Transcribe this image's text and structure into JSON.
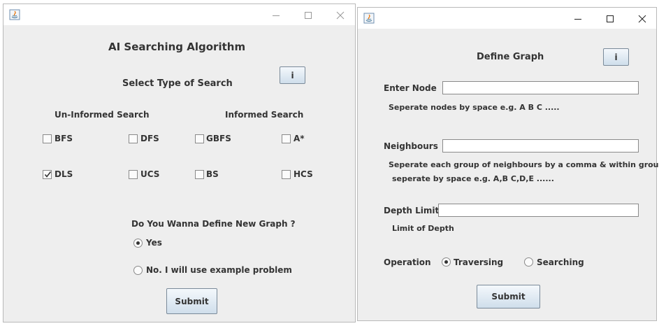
{
  "window1": {
    "title": "AI Searching Algorithm",
    "select_label": "Select Type of Search",
    "info_button": "i",
    "uninformed_label": "Un-Informed Search",
    "informed_label": "Informed Search",
    "options": {
      "bfs": {
        "label": "BFS",
        "checked": false
      },
      "dfs": {
        "label": "DFS",
        "checked": false
      },
      "gbfs": {
        "label": "GBFS",
        "checked": false
      },
      "astar": {
        "label": "A*",
        "checked": false
      },
      "dls": {
        "label": "DLS",
        "checked": true
      },
      "ucs": {
        "label": "UCS",
        "checked": false
      },
      "bs": {
        "label": "BS",
        "checked": false
      },
      "hcs": {
        "label": "HCS",
        "checked": false
      }
    },
    "question": "Do You Wanna Define New Graph ?",
    "yes_label": "Yes",
    "no_label": "No. I will use example problem",
    "selected_radio": "yes",
    "submit": "Submit"
  },
  "window2": {
    "title": "Define Graph",
    "info_button": "i",
    "enter_node_label": "Enter Node",
    "enter_node_value": "",
    "enter_node_hint": "Seperate nodes by space e.g. A B C .....",
    "neighbours_label": "Neighbours",
    "neighbours_value": "",
    "neighbours_hint_1": "Seperate each group of neighbours by a comma & within group",
    "neighbours_hint_2": "seperate by space e.g. A,B C,D,E ......",
    "depth_label": "Depth Limit",
    "depth_value": "",
    "depth_hint": "Limit of Depth",
    "operation_label": "Operation",
    "traversing_label": "Traversing",
    "searching_label": "Searching",
    "selected_operation": "traversing",
    "submit": "Submit"
  },
  "colors": {
    "window_bg": "#eeeeee",
    "titlebar_bg": "#ffffff",
    "text": "#333333",
    "button_top": "#f4f8fc",
    "button_bottom": "#cfdeeb",
    "java_icon": "#5382a1",
    "java_flame": "#e76f00"
  }
}
